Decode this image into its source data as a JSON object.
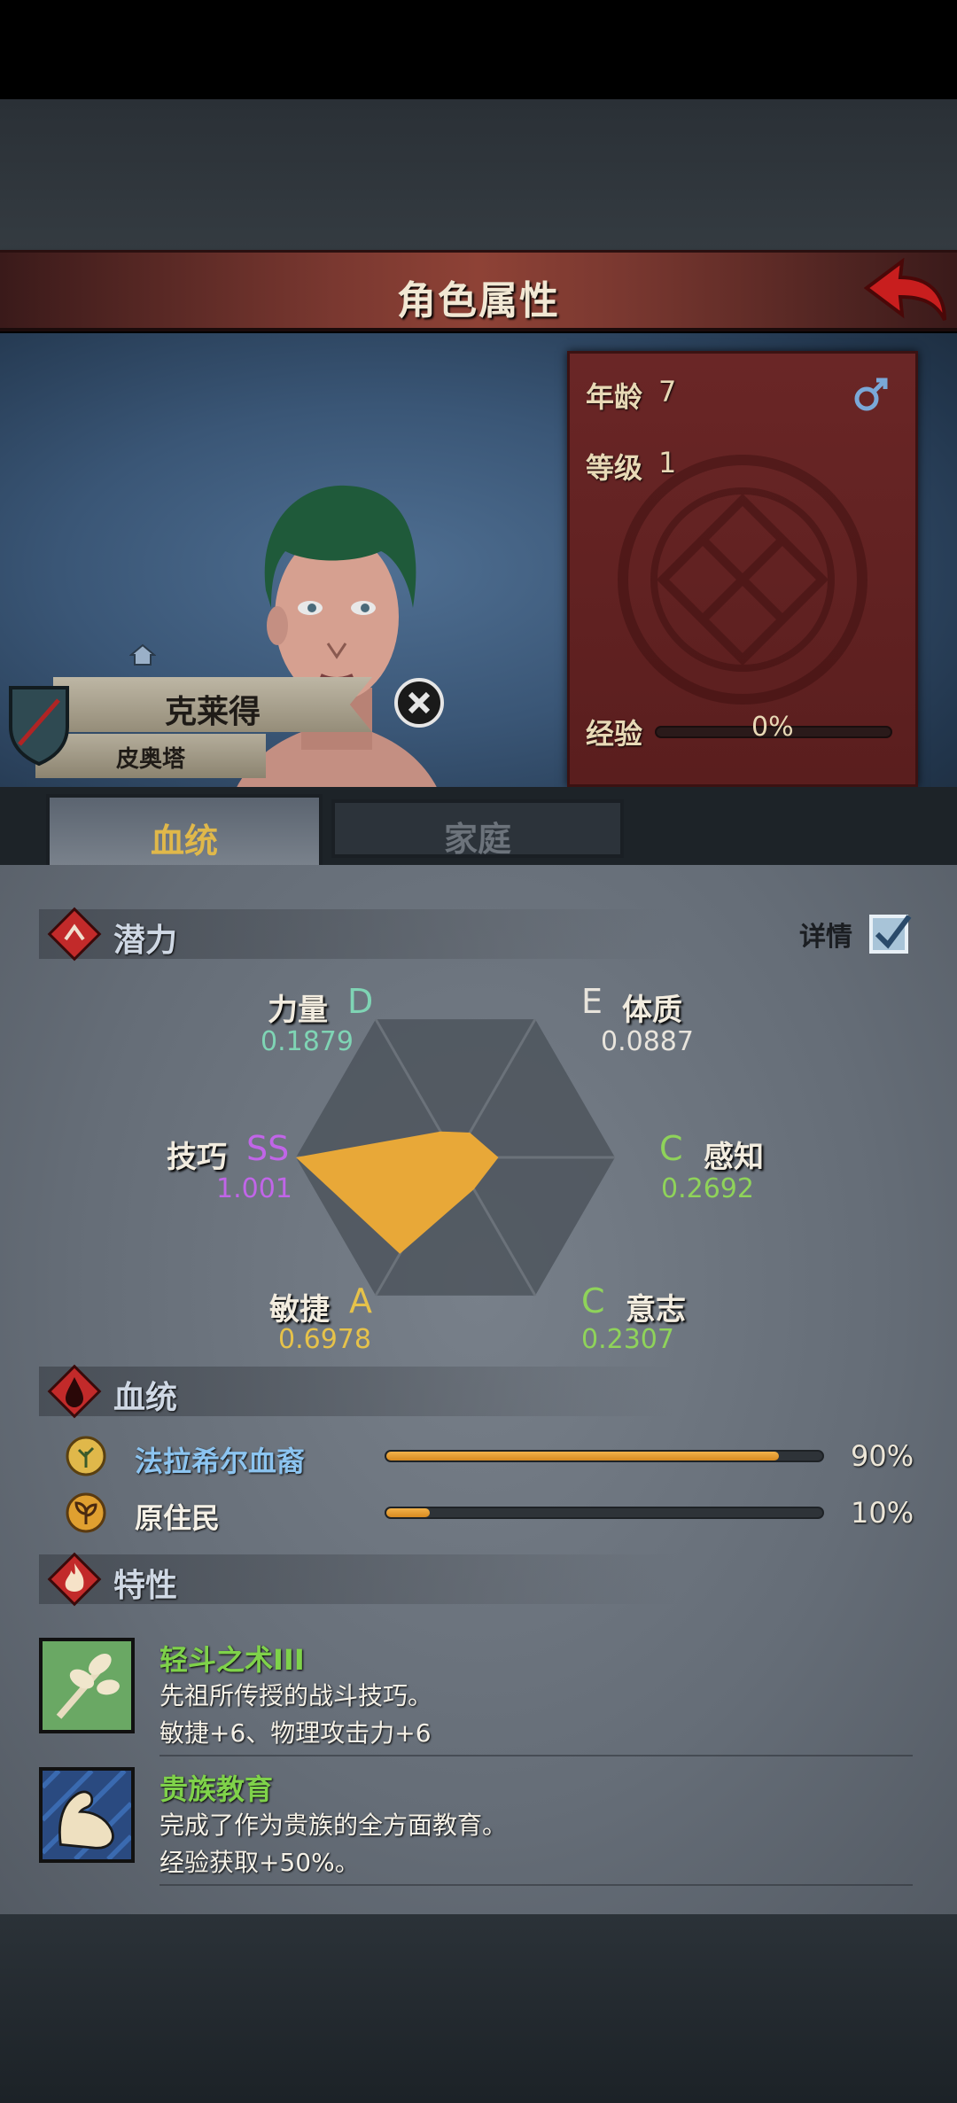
{
  "header": {
    "title": "角色属性"
  },
  "character": {
    "name": "克莱得",
    "region": "皮奥塔",
    "age_label": "年龄",
    "age": "7",
    "level_label": "等级",
    "level": "1",
    "exp_label": "经验",
    "exp_value": "0%",
    "exp_progress": 0
  },
  "tabs": [
    {
      "label": "血统",
      "active": true
    },
    {
      "label": "家庭",
      "active": false
    }
  ],
  "potential": {
    "title": "潜力",
    "detail_label": "详情",
    "detail_checked": true,
    "attributes": [
      {
        "name": "力量",
        "grade": "D",
        "value": "0.1879",
        "grade_color": "#7fd4b4",
        "value_color": "#7fd4b4"
      },
      {
        "name": "体质",
        "grade": "E",
        "value": "0.0887",
        "grade_color": "#e8e4dc",
        "value_color": "#e8e4dc"
      },
      {
        "name": "感知",
        "grade": "C",
        "value": "0.2692",
        "grade_color": "#8fd35a",
        "value_color": "#8fd35a"
      },
      {
        "name": "意志",
        "grade": "C",
        "value": "0.2307",
        "grade_color": "#8fd35a",
        "value_color": "#8fd35a"
      },
      {
        "name": "敏捷",
        "grade": "A",
        "value": "0.6978",
        "grade_color": "#e6c24a",
        "value_color": "#e6c24a"
      },
      {
        "name": "技巧",
        "grade": "SS",
        "value": "1.001",
        "grade_color": "#c165e8",
        "value_color": "#c165e8"
      }
    ]
  },
  "bloodline": {
    "title": "血统",
    "items": [
      {
        "name": "法拉希尔血裔",
        "percent": "90%",
        "fraction": 0.9,
        "name_color": "#8cc4f0",
        "icon": "tree-icon"
      },
      {
        "name": "原住民",
        "percent": "10%",
        "fraction": 0.1,
        "name_color": "#f4f0e6",
        "icon": "sprout-icon"
      }
    ]
  },
  "traits": {
    "title": "特性",
    "items": [
      {
        "name": "轻斗之术III",
        "desc": "先祖所传授的战斗技巧。",
        "effect": "敏捷+6、物理攻击力+6",
        "icon": "leaf-branch-icon"
      },
      {
        "name": "贵族教育",
        "desc": "完成了作为贵族的全方面教育。",
        "effect": "经验获取+50%。",
        "icon": "flexed-arm-icon"
      }
    ]
  },
  "colors": {
    "accent_gold": "#e0b84a",
    "header_red": "#7a3830",
    "radar_fill": "#e8a838"
  }
}
